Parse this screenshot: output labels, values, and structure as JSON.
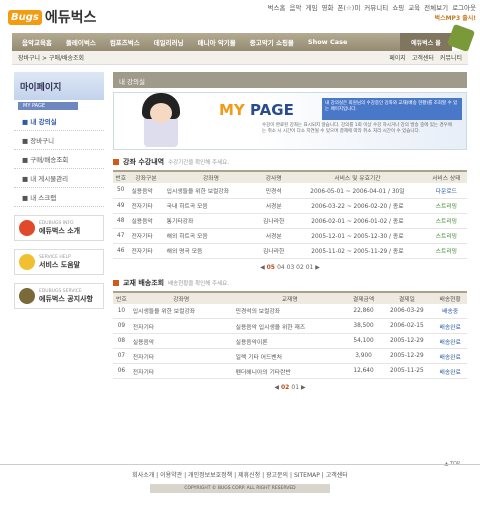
{
  "header": {
    "bugs": "Bugs",
    "brand": "에듀벅스",
    "topmenu": [
      "벅스홈",
      "음악",
      "게임",
      "영화",
      "폰(☆)미",
      "커뮤니티",
      "쇼핑",
      "교육",
      "전체보기",
      "로그아웃"
    ],
    "mp3": "벅스MP3 출시!",
    "gnb": [
      "음악교육홈",
      "플레이벅스",
      "컴포즈벅스",
      "데일리러닝",
      "매니아 악기몰",
      "중고악기 쇼핑몰",
      "Show Case"
    ],
    "gnb_right": "에듀벅스 몰",
    "breadcrumb": "장바구니  > 구매/배송조회",
    "sub_right": [
      "페이지",
      "고객센터",
      "커뮤니티"
    ]
  },
  "sidebar": {
    "title": "마이페이지",
    "caption": "MY PAGE",
    "items": [
      "내 강의실",
      "장바구니",
      "구매/배송조회",
      "내 게시물관리",
      "내 스크랩"
    ],
    "boxes": [
      {
        "t1": "EDUBUGS INFO",
        "t2": "에듀벅스 소개",
        "color": "#e04a2a"
      },
      {
        "t1": "SERVICE HELP",
        "t2": "서비스 도움말",
        "color": "#f0c030"
      },
      {
        "t1": "EDUBUGS SERVICE",
        "t2": "에듀벅스 공지사항",
        "color": "#7a6a3a"
      }
    ]
  },
  "main": {
    "head": "내 강의실",
    "banner": {
      "my": "MY",
      "page": "PAGE",
      "box": "내 강의실은 회원님의 수강중인 강좌와 교재(배송 현황)를 조회할 수 있는 페이지입니다.",
      "text": "수강이 완료된 강좌는 표시되지 않습니다. 강의를 1회 이상 수강 하시거나 강의 발송 중에 있는 경우에는 취소 시 시간이 다소 지연될 수 있으며 결제에 따라 취소 처리 시간이 수 있습니다."
    },
    "courses": {
      "title": "강좌 수강내역",
      "hint": "수강기간을 확인해 주세요.",
      "headers": [
        "번호",
        "강좌구분",
        "강좌명",
        "강사명",
        "서비스 및 유효기간",
        "서비스 상태"
      ],
      "rows": [
        [
          "50",
          "실용음악",
          "입시생들을 위한 보컬강좌",
          "민경석",
          "2006-05-01 ~ 2006-04-01 / 30일",
          "다운로드"
        ],
        [
          "49",
          "전자기타",
          "국내 히트곡 모음",
          "서경분",
          "2006-03-22 ~ 2006-02-20 / 종료",
          "스트리밍"
        ],
        [
          "48",
          "실용음악",
          "통기타강좌",
          "김나라한",
          "2006-02-01 ~ 2006-01-02 / 종료",
          "스트리밍"
        ],
        [
          "47",
          "전자기타",
          "해외 히트곡 모음",
          "서경분",
          "2005-12-01 ~ 2005-12-30 / 종료",
          "스트리밍"
        ],
        [
          "46",
          "전자기타",
          "해외 명곡 모음",
          "김나라한",
          "2005-11-02 ~ 2005-11-29 / 종료",
          "스트리밍"
        ]
      ],
      "pager": [
        "05",
        "04",
        "03",
        "02",
        "01"
      ]
    },
    "books": {
      "title": "교재 배송조회",
      "hint": "배송현황을 확인해 주세요.",
      "headers": [
        "번호",
        "강좌명",
        "교재명",
        "결제금액",
        "결제일",
        "배송현황"
      ],
      "rows": [
        [
          "10",
          "입시생들을 위한 보컬강좌",
          "민경석의 보컬강좌",
          "22,860",
          "2006-03-29",
          "배송중"
        ],
        [
          "09",
          "전자기타",
          "실용음악 입시생을 위한 재즈",
          "38,500",
          "2006-02-15",
          "배송완료"
        ],
        [
          "08",
          "실용음악",
          "실용음악이론",
          "54,100",
          "2005-12-29",
          "배송완료"
        ],
        [
          "07",
          "전자기타",
          "일렉 기타 어드벤처",
          "3,900",
          "2005-12-29",
          "배송완료"
        ],
        [
          "06",
          "전자기타",
          "펜더헤니아의 기타란반",
          "12,640",
          "2005-11-25",
          "배송완료"
        ]
      ],
      "pager": [
        "02",
        "01"
      ]
    }
  },
  "footer": {
    "links": [
      "회사소개",
      "이용약관",
      "개인정보보호정책",
      "제휴신청",
      "광고문의",
      "SITEMAP",
      "고객센터"
    ],
    "copy": "COPYRIGHT © BUGS CORP. ALL RIGHT RESERVED",
    "top": "▲ TOP"
  }
}
